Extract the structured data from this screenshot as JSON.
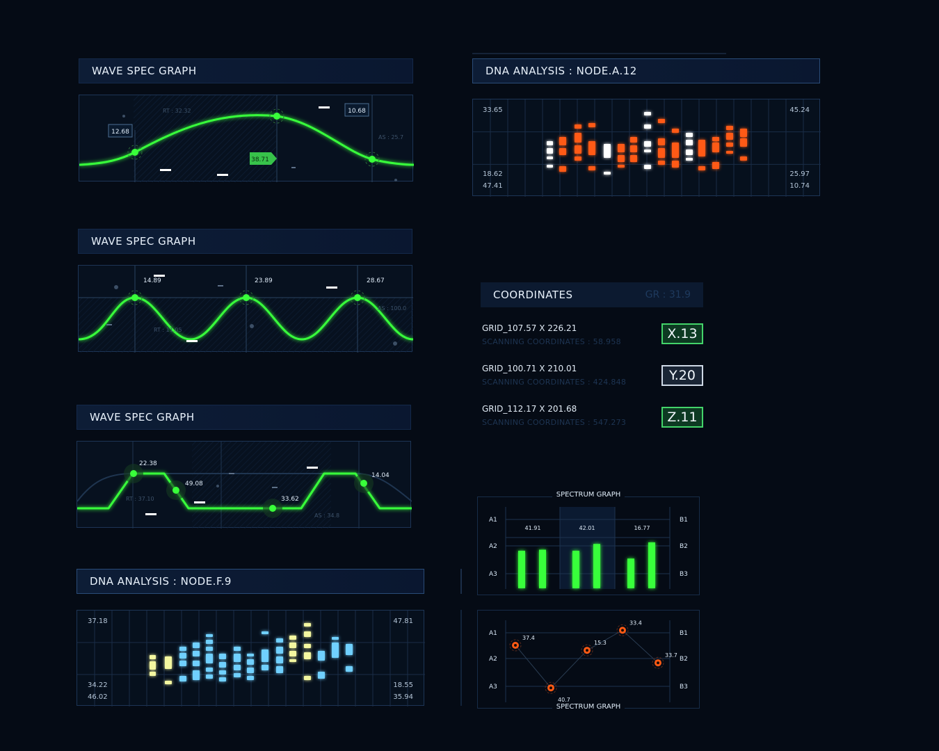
{
  "wave1": {
    "title": "WAVE SPEC GRAPH",
    "labels": {
      "rt": "RT : 32.32",
      "as": "AS : 25.7",
      "p1": "12.68",
      "p2": "10.68",
      "p3": "38.71"
    }
  },
  "wave2": {
    "title": "WAVE SPEC GRAPH",
    "labels": {
      "p1": "14.89",
      "p2": "23.89",
      "p3": "28.67",
      "rt": "RT : 11.05",
      "as": "AS : 100.0"
    }
  },
  "wave3": {
    "title": "WAVE SPEC GRAPH",
    "labels": {
      "p1": "22.38",
      "p2": "49.08",
      "p3": "33.62",
      "p4": "14.04",
      "rt": "RT : 37.10",
      "as": "AS : 34.8"
    }
  },
  "dna_f": {
    "title": "DNA ANALYSIS : NODE.F.9",
    "corners": {
      "tl": "37.18",
      "tr": "47.81",
      "bl1": "34.22",
      "bl2": "46.02",
      "br1": "18.55",
      "br2": "35.94"
    }
  },
  "dna_a": {
    "title": "DNA ANALYSIS : NODE.A.12",
    "corners": {
      "tl": "33.65",
      "tr": "45.24",
      "bl1": "18.62",
      "bl2": "47.41",
      "br1": "25.97",
      "br2": "10.74"
    }
  },
  "coordinates": {
    "title": "COORDINATES",
    "gr": "GR : 31.9",
    "rows": [
      {
        "grid": "GRID_107.57 X 226.21",
        "scan": "SCANNING COORDINATES : 58.958",
        "badge": "X.13"
      },
      {
        "grid": "GRID_100.71 X 210.01",
        "scan": "SCANNING COORDINATES : 424.848",
        "badge": "Y.20"
      },
      {
        "grid": "GRID_112.17 X 201.68",
        "scan": "SCANNING COORDINATES : 547.273",
        "badge": "Z.11"
      }
    ]
  },
  "spectrum_bar": {
    "title": "SPECTRUM GRAPH",
    "left_labels": [
      "A1",
      "A2",
      "A3"
    ],
    "right_labels": [
      "B1",
      "B2",
      "B3"
    ]
  },
  "spectrum_scatter": {
    "title": "SPECTRUM GRAPH",
    "left_labels": [
      "A1",
      "A2",
      "A3"
    ],
    "right_labels": [
      "B1",
      "B2",
      "B3"
    ]
  },
  "colors": {
    "green": "#39ff3a",
    "orange": "#ff5a14",
    "cyan": "#6fd0ff",
    "yellow": "#f4f7a0"
  },
  "chart_data": [
    {
      "type": "bar",
      "categories": [
        "41.91",
        "42.01",
        "16.77"
      ],
      "series": [
        {
          "values": [
            0.72,
            0.74
          ]
        },
        {
          "values": [
            0.72,
            0.85
          ]
        },
        {
          "values": [
            0.57,
            0.88
          ]
        }
      ],
      "title": "SPECTRUM GRAPH",
      "ylim": [
        0,
        1
      ]
    },
    {
      "type": "scatter",
      "points": [
        {
          "label": "37.4",
          "x": 0,
          "y": 2.0
        },
        {
          "label": "40.7",
          "x": 1,
          "y": 0.3
        },
        {
          "label": "15.3",
          "x": 2,
          "y": 1.8
        },
        {
          "label": "33.4",
          "x": 3,
          "y": 2.6
        },
        {
          "label": "33.7",
          "x": 4,
          "y": 1.3
        }
      ],
      "title": "SPECTRUM GRAPH"
    }
  ]
}
